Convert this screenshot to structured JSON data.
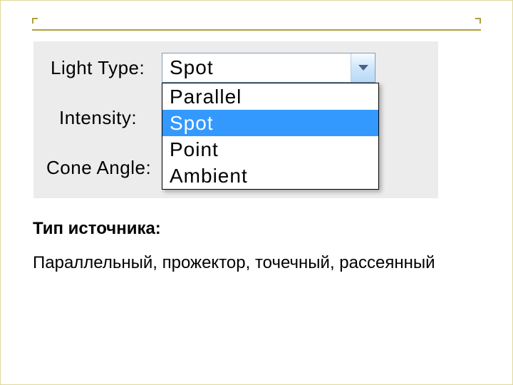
{
  "panel": {
    "labels": {
      "light_type": "Light Type:",
      "intensity": "Intensity:",
      "cone_angle": "Cone Angle:"
    },
    "combo_value": "Spot",
    "options": [
      "Parallel",
      "Spot",
      "Point",
      "Ambient"
    ],
    "selected_index": 1
  },
  "caption": {
    "heading": "Тип источника:",
    "desc": "Параллельный, прожектор, точечный, рассеянный"
  }
}
